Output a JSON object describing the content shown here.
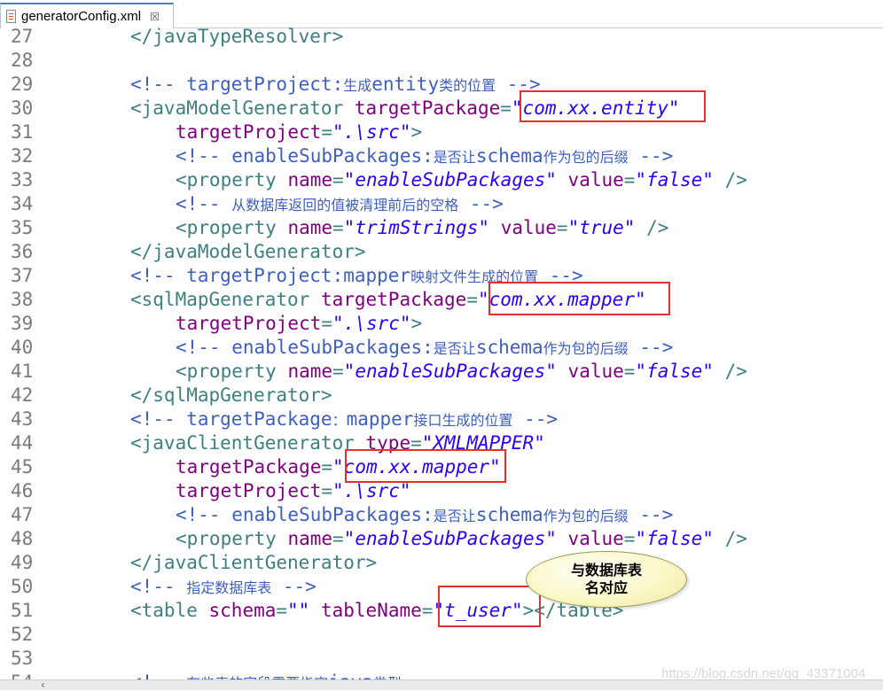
{
  "tab": {
    "title": "generatorConfig.xml",
    "close": "☒"
  },
  "callout": {
    "line1": "与数据库表",
    "line2": "名对应"
  },
  "watermark": "https://blog.csdn.net/qq_43371004",
  "lines": [
    {
      "num": "27",
      "segs": [
        {
          "c": "kw",
          "t": "</javaTypeResolver>"
        }
      ]
    },
    {
      "num": "28",
      "segs": []
    },
    {
      "num": "29",
      "segs": [
        {
          "c": "cm",
          "t": "<!-- targetProject:"
        },
        {
          "c": "cm cjk",
          "t": "生成"
        },
        {
          "c": "cm",
          "t": "entity"
        },
        {
          "c": "cm cjk",
          "t": "类的位置"
        },
        {
          "c": "cm",
          "t": " -->"
        }
      ]
    },
    {
      "num": "30",
      "segs": [
        {
          "c": "kw",
          "t": "<javaModelGenerator "
        },
        {
          "c": "at",
          "t": "targetPackage"
        },
        {
          "c": "kw",
          "t": "="
        },
        {
          "c": "vl",
          "t": "\"com.xx.entity\""
        }
      ]
    },
    {
      "num": "31",
      "indent": true,
      "segs": [
        {
          "c": "at",
          "t": "targetProject"
        },
        {
          "c": "kw",
          "t": "="
        },
        {
          "c": "vl",
          "t": "\".\\src\""
        },
        {
          "c": "kw",
          "t": ">"
        }
      ]
    },
    {
      "num": "32",
      "indent": true,
      "segs": [
        {
          "c": "cm",
          "t": "<!-- enableSubPackages:"
        },
        {
          "c": "cm cjk",
          "t": "是否让"
        },
        {
          "c": "cm",
          "t": "schema"
        },
        {
          "c": "cm cjk",
          "t": "作为包的后缀"
        },
        {
          "c": "cm",
          "t": " -->"
        }
      ]
    },
    {
      "num": "33",
      "indent": true,
      "segs": [
        {
          "c": "kw",
          "t": "<property "
        },
        {
          "c": "at",
          "t": "name"
        },
        {
          "c": "kw",
          "t": "="
        },
        {
          "c": "vl",
          "t": "\"enableSubPackages\""
        },
        {
          "c": "kw",
          "t": " "
        },
        {
          "c": "at",
          "t": "value"
        },
        {
          "c": "kw",
          "t": "="
        },
        {
          "c": "vl",
          "t": "\"false\""
        },
        {
          "c": "kw",
          "t": " />"
        }
      ]
    },
    {
      "num": "34",
      "indent": true,
      "segs": [
        {
          "c": "cm",
          "t": "<!-- "
        },
        {
          "c": "cm cjk",
          "t": "从数据库返回的值被清理前后的空格"
        },
        {
          "c": "cm",
          "t": " -->"
        }
      ]
    },
    {
      "num": "35",
      "indent": true,
      "segs": [
        {
          "c": "kw",
          "t": "<property "
        },
        {
          "c": "at",
          "t": "name"
        },
        {
          "c": "kw",
          "t": "="
        },
        {
          "c": "vl",
          "t": "\"trimStrings\""
        },
        {
          "c": "kw",
          "t": " "
        },
        {
          "c": "at",
          "t": "value"
        },
        {
          "c": "kw",
          "t": "="
        },
        {
          "c": "vl",
          "t": "\"true\""
        },
        {
          "c": "kw",
          "t": " />"
        }
      ]
    },
    {
      "num": "36",
      "segs": [
        {
          "c": "kw",
          "t": "</javaModelGenerator>"
        }
      ]
    },
    {
      "num": "37",
      "segs": [
        {
          "c": "cm",
          "t": "<!-- targetProject:mapper"
        },
        {
          "c": "cm cjk",
          "t": "映射文件生成的位置"
        },
        {
          "c": "cm",
          "t": " -->"
        }
      ]
    },
    {
      "num": "38",
      "segs": [
        {
          "c": "kw",
          "t": "<sqlMapGenerator "
        },
        {
          "c": "at",
          "t": "targetPackage"
        },
        {
          "c": "kw",
          "t": "="
        },
        {
          "c": "vl",
          "t": "\"com.xx.mapper\""
        }
      ]
    },
    {
      "num": "39",
      "indent": true,
      "segs": [
        {
          "c": "at",
          "t": "targetProject"
        },
        {
          "c": "kw",
          "t": "="
        },
        {
          "c": "vl",
          "t": "\".\\src\""
        },
        {
          "c": "kw",
          "t": ">"
        }
      ]
    },
    {
      "num": "40",
      "indent": true,
      "segs": [
        {
          "c": "cm",
          "t": "<!-- enableSubPackages:"
        },
        {
          "c": "cm cjk",
          "t": "是否让"
        },
        {
          "c": "cm",
          "t": "schema"
        },
        {
          "c": "cm cjk",
          "t": "作为包的后缀"
        },
        {
          "c": "cm",
          "t": " -->"
        }
      ]
    },
    {
      "num": "41",
      "indent": true,
      "segs": [
        {
          "c": "kw",
          "t": "<property "
        },
        {
          "c": "at",
          "t": "name"
        },
        {
          "c": "kw",
          "t": "="
        },
        {
          "c": "vl",
          "t": "\"enableSubPackages\""
        },
        {
          "c": "kw",
          "t": " "
        },
        {
          "c": "at",
          "t": "value"
        },
        {
          "c": "kw",
          "t": "="
        },
        {
          "c": "vl",
          "t": "\"false\""
        },
        {
          "c": "kw",
          "t": " />"
        }
      ]
    },
    {
      "num": "42",
      "segs": [
        {
          "c": "kw",
          "t": "</sqlMapGenerator>"
        }
      ]
    },
    {
      "num": "43",
      "segs": [
        {
          "c": "cm",
          "t": "<!-- targetPackage"
        },
        {
          "c": "cm cjk",
          "t": "："
        },
        {
          "c": "cm",
          "t": "mapper"
        },
        {
          "c": "cm cjk",
          "t": "接口生成的位置"
        },
        {
          "c": "cm",
          "t": " -->"
        }
      ]
    },
    {
      "num": "44",
      "segs": [
        {
          "c": "kw",
          "t": "<javaClientGenerator "
        },
        {
          "c": "at",
          "t": "type"
        },
        {
          "c": "kw",
          "t": "="
        },
        {
          "c": "vl",
          "t": "\"XMLMAPPER\""
        }
      ]
    },
    {
      "num": "45",
      "indent": true,
      "segs": [
        {
          "c": "at",
          "t": "targetPackage"
        },
        {
          "c": "kw",
          "t": "="
        },
        {
          "c": "vl",
          "t": "\"com.xx.mapper\""
        }
      ]
    },
    {
      "num": "46",
      "indent": true,
      "segs": [
        {
          "c": "at",
          "t": "targetProject"
        },
        {
          "c": "kw",
          "t": "="
        },
        {
          "c": "vl",
          "t": "\".\\src\""
        }
      ]
    },
    {
      "num": "47",
      "indent": true,
      "segs": [
        {
          "c": "cm",
          "t": "<!-- enableSubPackages:"
        },
        {
          "c": "cm cjk",
          "t": "是否让"
        },
        {
          "c": "cm",
          "t": "schema"
        },
        {
          "c": "cm cjk",
          "t": "作为包的后缀"
        },
        {
          "c": "cm",
          "t": " -->"
        }
      ]
    },
    {
      "num": "48",
      "indent": true,
      "segs": [
        {
          "c": "kw",
          "t": "<property "
        },
        {
          "c": "at",
          "t": "name"
        },
        {
          "c": "kw",
          "t": "="
        },
        {
          "c": "vl",
          "t": "\"enableSubPackages\""
        },
        {
          "c": "kw",
          "t": " "
        },
        {
          "c": "at",
          "t": "value"
        },
        {
          "c": "kw",
          "t": "="
        },
        {
          "c": "vl",
          "t": "\"false\""
        },
        {
          "c": "kw",
          "t": " />"
        }
      ]
    },
    {
      "num": "49",
      "segs": [
        {
          "c": "kw",
          "t": "</javaClientGenerator>"
        }
      ]
    },
    {
      "num": "50",
      "segs": [
        {
          "c": "cm",
          "t": "<!-- "
        },
        {
          "c": "cm cjk",
          "t": "指定数据库表"
        },
        {
          "c": "cm",
          "t": " -->"
        }
      ]
    },
    {
      "num": "51",
      "segs": [
        {
          "c": "kw",
          "t": "<table "
        },
        {
          "c": "at",
          "t": "schema"
        },
        {
          "c": "kw",
          "t": "="
        },
        {
          "c": "vl",
          "t": "\"\""
        },
        {
          "c": "kw",
          "t": " "
        },
        {
          "c": "at",
          "t": "tableName"
        },
        {
          "c": "kw",
          "t": "="
        },
        {
          "c": "vl",
          "t": "\"t_user\""
        },
        {
          "c": "kw",
          "t": "></table>"
        }
      ]
    },
    {
      "num": "52",
      "segs": []
    },
    {
      "num": "53",
      "segs": []
    },
    {
      "num": "54",
      "segs": [
        {
          "c": "cm",
          "t": "<!-- "
        },
        {
          "c": "cm cjk",
          "t": "有些表的字段需要指定"
        },
        {
          "c": "cm",
          "t": "java"
        },
        {
          "c": "cm cjk",
          "t": "类型"
        }
      ]
    }
  ]
}
